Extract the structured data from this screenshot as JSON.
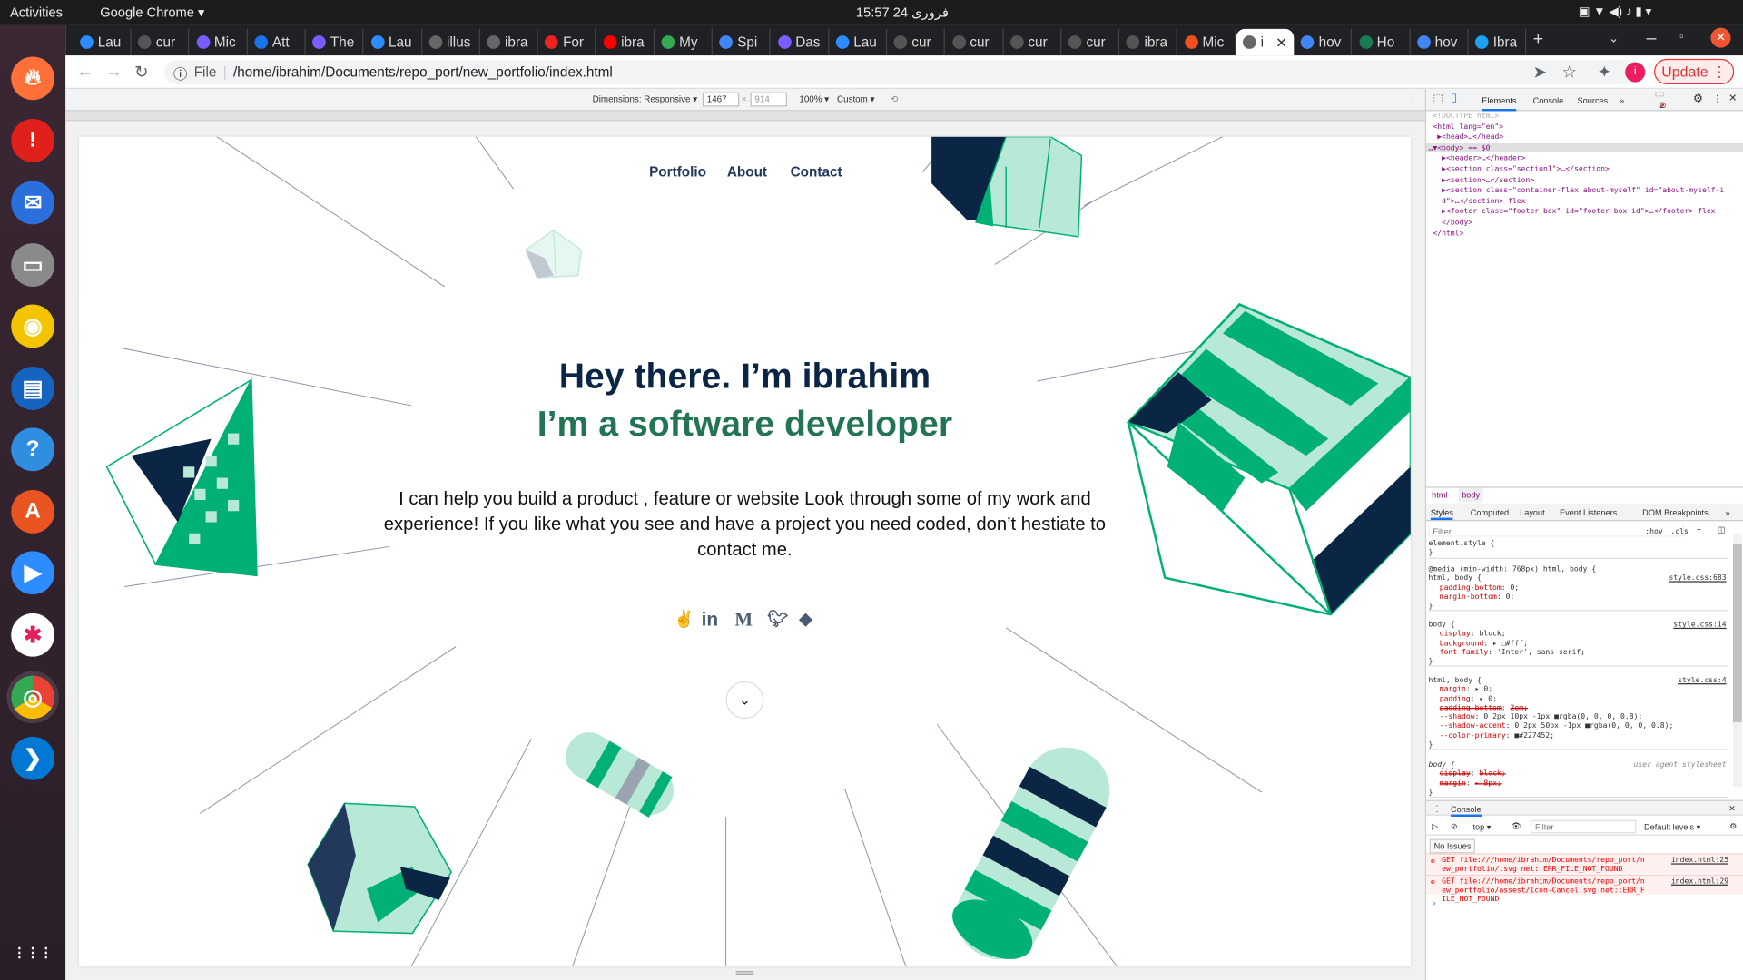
{
  "os": {
    "activities": "Activities",
    "app_name": "Google Chrome ▾",
    "clock": "15:57  24 فروری"
  },
  "dock": [
    "firefox",
    "update-notifier",
    "thunderbird",
    "files",
    "rhythmbox",
    "libreoffice-writer",
    "help",
    "software-center",
    "zoom",
    "slack",
    "chrome",
    "vscode"
  ],
  "tabs": [
    {
      "title": "Lau",
      "color": "#2d8cff"
    },
    {
      "title": "cur",
      "color": "#555"
    },
    {
      "title": "Mic",
      "color": "#7b5cff"
    },
    {
      "title": "Att",
      "color": "#1a73e8"
    },
    {
      "title": "The",
      "color": "#7b5cff"
    },
    {
      "title": "Lau",
      "color": "#2d8cff"
    },
    {
      "title": "illus",
      "color": "#666"
    },
    {
      "title": "ibra",
      "color": "#666"
    },
    {
      "title": "For",
      "color": "#e22"
    },
    {
      "title": "ibra",
      "color": "#f00"
    },
    {
      "title": "My",
      "color": "#34a853"
    },
    {
      "title": "Spi",
      "color": "#4285f4"
    },
    {
      "title": "Das",
      "color": "#7b5cff"
    },
    {
      "title": "Lau",
      "color": "#2d8cff"
    },
    {
      "title": "cur",
      "color": "#555"
    },
    {
      "title": "cur",
      "color": "#555"
    },
    {
      "title": "cur",
      "color": "#555"
    },
    {
      "title": "cur",
      "color": "#555"
    },
    {
      "title": "ibra",
      "color": "#555"
    },
    {
      "title": "Mic",
      "color": "#f24e1e"
    },
    {
      "title": "i",
      "color": "#666",
      "active": true
    },
    {
      "title": "hov",
      "color": "#4285f4"
    },
    {
      "title": "Ho",
      "color": "#1a7a50"
    },
    {
      "title": "hov",
      "color": "#4285f4"
    },
    {
      "title": "Ibra",
      "color": "#1da1f2"
    }
  ],
  "browser": {
    "file_label": "File",
    "url": "/home/ibrahim/Documents/repo_port/new_portfolio/index.html",
    "update": "Update"
  },
  "device_toolbar": {
    "dimensions": "Dimensions: Responsive ▾",
    "width": "1467",
    "x": "×",
    "height": "914",
    "zoom": "100% ▾",
    "throttle": "Custom ▾"
  },
  "page": {
    "nav": [
      "Portfolio",
      "About",
      "Contact"
    ],
    "headline1": "Hey there. I’m ibrahim",
    "headline2": "I’m a software developer",
    "intro": "I can help you build a product , feature or website Look through some of my work and experience! If you like what you see and have a project you need coded, don’t hestiate to contact me.",
    "social": [
      "angellist",
      "linkedin",
      "medium",
      "twitter",
      "github"
    ],
    "colors": {
      "navy": "#0b2545",
      "green": "#227452",
      "mint": "#b8e8d6",
      "accent": "#00b074"
    }
  },
  "devtools": {
    "tabs": [
      "Elements",
      "Console",
      "Sources",
      "»"
    ],
    "error_count": "2",
    "dom": [
      "<!DOCTYPE html>",
      "<html lang=\"en\">",
      "▶<head>…</head>",
      "…▼<body> == $0",
      "▶<header>…</header>",
      "▶<section class=\"section1\">…</section>",
      "▶<section>…</section>",
      "▶<section class=\"container-flex about-myself\" id=\"about-myself-i",
      "d\">…</section> flex",
      "▶<footer class=\"footer-box\" id=\"footer-box-id\">…</footer> flex",
      "</body>",
      "</html>"
    ],
    "breadcrumb": [
      "html",
      "body"
    ],
    "style_tabs": [
      "Styles",
      "Computed",
      "Layout",
      "Event Listeners",
      "DOM Breakpoints",
      "»"
    ],
    "filter_placeholder": "Filter",
    "hov": ":hov",
    ".cls": ".cls",
    "rules": [
      {
        "selector": "element.style {",
        "source": "",
        "props": [],
        "end": "}"
      },
      {
        "selector": "@media (min-width: 768px)\nhtml, body {",
        "source": "style.css:683",
        "props": [
          [
            "padding-bottom",
            "0;"
          ],
          [
            "margin-bottom",
            "0;"
          ]
        ],
        "end": "}"
      },
      {
        "selector": "body {",
        "source": "style.css:14",
        "props": [
          [
            "display",
            "block;"
          ],
          [
            "background",
            "▸ □#fff;"
          ],
          [
            "font-family",
            "'Inter', sans-serif;"
          ]
        ],
        "end": "}"
      },
      {
        "selector": "html, body {",
        "source": "style.css:4",
        "props": [
          [
            "margin",
            "▸ 0;"
          ],
          [
            "padding",
            "▸ 0;"
          ],
          [
            "~padding-bottom",
            "2em;"
          ],
          [
            "--shadow",
            "0 2px 10px -1px ■rgba(0, 0, 0, 0.8);"
          ],
          [
            "--shadow-accent",
            "0 2px 50px -1px ■rgba(0, 0, 0, 0.8);"
          ],
          [
            "--color-primary",
            "■#227452;"
          ]
        ],
        "end": "}"
      },
      {
        "selector": "body {",
        "source": "user agent stylesheet",
        "props": [
          [
            "~display",
            "block;"
          ],
          [
            "~margin",
            "▸ 8px;"
          ]
        ],
        "end": "}"
      }
    ],
    "console": {
      "title": "Console",
      "context": "top ▾",
      "filter": "Filter",
      "levels": "Default levels ▾",
      "issues": "No Issues",
      "errors": [
        {
          "text": "GET file:///home/ibrahim/Documents/repo_port/new_portfolio/.svg net::ERR_FILE_NOT_FOUND",
          "source": "index.html:25"
        },
        {
          "text": "GET file:///home/ibrahim/Documents/repo_port/new_portfolio/assest/Icon-Cancel.svg net::ERR_FILE_NOT_FOUND",
          "source": "index.html:29"
        }
      ]
    }
  }
}
